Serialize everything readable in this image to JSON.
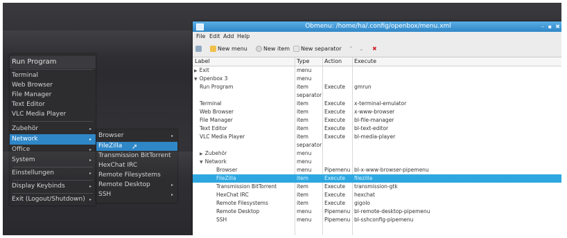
{
  "openbox_menu": {
    "title": "Run Program",
    "items": [
      {
        "label": "Terminal"
      },
      {
        "label": "Web Browser"
      },
      {
        "label": "File Manager"
      },
      {
        "label": "Text Editor"
      },
      {
        "label": "VLC Media Player"
      },
      {
        "label": "Zubehör",
        "arrow": "▸"
      },
      {
        "label": "Network",
        "arrow": "▸"
      },
      {
        "label": "Office",
        "arrow": "▸"
      },
      {
        "label": "System",
        "arrow": "▸"
      },
      {
        "label": "Einstellungen",
        "arrow": "▸"
      },
      {
        "label": "Display Keybinds",
        "arrow": "▸"
      },
      {
        "label": "Exit (Logout/Shutdown)",
        "arrow": "▸"
      }
    ]
  },
  "network_submenu": {
    "items": [
      {
        "label": "Browser",
        "arrow": "▸"
      },
      {
        "label": "FileZilla"
      },
      {
        "label": "Transmission BitTorrent"
      },
      {
        "label": "HexChat IRC"
      },
      {
        "label": "Remote Filesystems"
      },
      {
        "label": "Remote Desktop",
        "arrow": "▸"
      },
      {
        "label": "SSH",
        "arrow": "▸"
      }
    ]
  },
  "window": {
    "title": "Obmenu: /home/ha/.config/openbox/menu.xml",
    "controls": {
      "minimize": "–",
      "maximize": "▪",
      "close": "✖"
    },
    "menubar": [
      "File",
      "Edit",
      "Add",
      "Help"
    ],
    "toolbar": {
      "new_menu": "New menu",
      "new_item": "New item",
      "new_separator": "New separator",
      "up": "⌃",
      "down": "⌄",
      "remove": "✖"
    },
    "columns": {
      "label": "Label",
      "type": "Type",
      "action": "Action",
      "execute": "Execute"
    },
    "rows": [
      {
        "label": "Exit",
        "tree": "▶",
        "type": "menu",
        "action": "",
        "execute": ""
      },
      {
        "label": "Openbox 3",
        "tree": "▼",
        "type": "menu",
        "action": "",
        "execute": ""
      },
      {
        "label": "Run Program",
        "type": "item",
        "action": "Execute",
        "execute": "gmrun"
      },
      {
        "label": "",
        "type": "separator",
        "action": "",
        "execute": ""
      },
      {
        "label": "Terminal",
        "type": "item",
        "action": "Execute",
        "execute": "x-terminal-emulator"
      },
      {
        "label": "Web Browser",
        "type": "item",
        "action": "Execute",
        "execute": "x-www-browser"
      },
      {
        "label": "File Manager",
        "type": "item",
        "action": "Execute",
        "execute": "bl-file-manager"
      },
      {
        "label": "Text Editor",
        "type": "item",
        "action": "Execute",
        "execute": "bl-text-editor"
      },
      {
        "label": "VLC Media Player",
        "type": "item",
        "action": "Execute",
        "execute": "bl-media-player"
      },
      {
        "label": "",
        "type": "separator",
        "action": "",
        "execute": ""
      },
      {
        "label": "Zubehör",
        "tree": "▶",
        "type": "menu",
        "action": "",
        "execute": ""
      },
      {
        "label": "Network",
        "tree": "▼",
        "type": "menu",
        "action": "",
        "execute": ""
      },
      {
        "label": "Browser",
        "type": "menu",
        "action": "Pipemenu",
        "execute": "bl-x-www-browser-pipemenu"
      },
      {
        "label": "FileZilla",
        "type": "item",
        "action": "Execute",
        "execute": "filezilla"
      },
      {
        "label": "Transmission BitTorrent",
        "type": "item",
        "action": "Execute",
        "execute": "transmission-gtk"
      },
      {
        "label": "HexChat IRC",
        "type": "item",
        "action": "Execute",
        "execute": "hexchat"
      },
      {
        "label": "Remote Filesystems",
        "type": "item",
        "action": "Execute",
        "execute": "gigolo"
      },
      {
        "label": "Remote Desktop",
        "type": "menu",
        "action": "Pipemenu",
        "execute": "bl-remote-desktop-pipemenu"
      },
      {
        "label": "SSH",
        "type": "menu",
        "action": "Pipemenu",
        "execute": "bl-sshconfig-pipemenu"
      }
    ]
  },
  "colors": {
    "selection_blue": "#2f87c8",
    "row_selection": "#2ea7e0",
    "menu_bg": "#2d2d30",
    "titlebar": "#3d96d6"
  }
}
